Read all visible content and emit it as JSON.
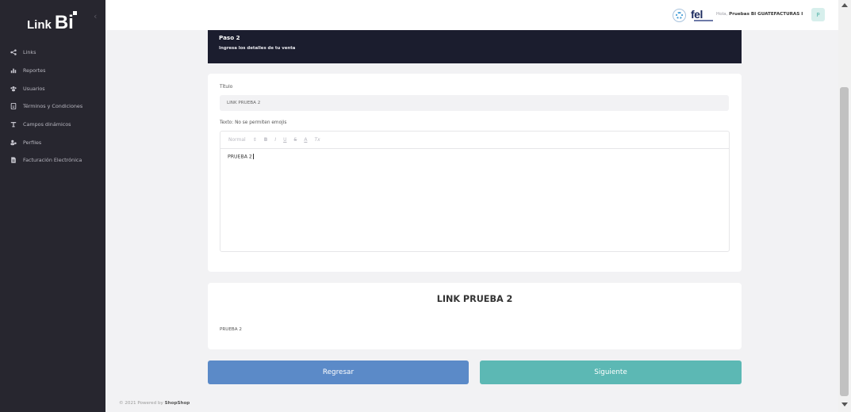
{
  "brand": {
    "text1": "Link",
    "text2": "Bi",
    "collapse": "‹"
  },
  "nav": [
    {
      "label": "Links",
      "icon": "share-icon"
    },
    {
      "label": "Reportes",
      "icon": "bar-chart-icon"
    },
    {
      "label": "Usuarios",
      "icon": "users-icon"
    },
    {
      "label": "Términos y Condiciones",
      "icon": "document-icon"
    },
    {
      "label": "Campos dinámicos",
      "icon": "text-field-icon"
    },
    {
      "label": "Perfiles",
      "icon": "profiles-icon"
    },
    {
      "label": "Facturación Electrónica",
      "icon": "invoice-icon"
    }
  ],
  "header": {
    "fel_logo": "fel",
    "greeting_prefix": "Hola,",
    "user_name": "Pruebas BI GUATEFACTURAS I",
    "avatar_letter": "P"
  },
  "step": {
    "title": "Paso 2",
    "subtitle": "Ingresa los detalles de tu venta"
  },
  "form": {
    "title_label": "Título",
    "title_value": "LINK PRUEBA 2",
    "text_label": "Texto: No se permiten emojis",
    "toolbar": {
      "format": "Normal",
      "format_arrow": "⇕",
      "bold": "B",
      "italic": "I",
      "underline": "U",
      "strike": "S",
      "color": "A",
      "clear": "Tx"
    },
    "editor_content": "PRUEBA 2"
  },
  "preview": {
    "title": "LINK PRUEBA 2",
    "text": "PRUEBA 2"
  },
  "actions": {
    "back": "Regresar",
    "next": "Siguiente"
  },
  "footer": {
    "prefix": "© 2021 Powered by",
    "brand": "ShopShop"
  },
  "colors": {
    "sidebar": "#27262f",
    "header_dark": "#1b1d2e",
    "back_button": "#5b8ac8",
    "next_button": "#5cb8b4"
  }
}
